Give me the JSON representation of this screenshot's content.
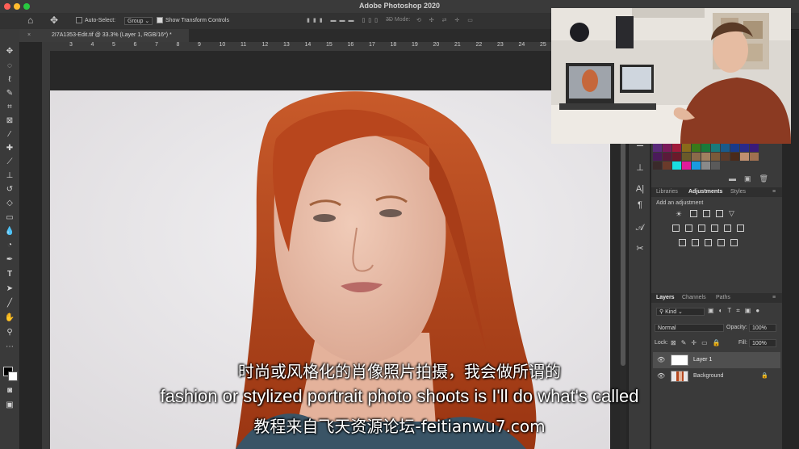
{
  "window": {
    "title": "Adobe Photoshop 2020"
  },
  "options_bar": {
    "auto_select_label": "Auto-Select:",
    "auto_select_value": "Group",
    "show_transform_label": "Show Transform Controls",
    "mode_3d_label": "3D Mode:"
  },
  "document": {
    "tab_title": "2I7A1353-Edit.tif @ 33.3% (Layer 1, RGB/16*) *"
  },
  "ruler": {
    "ticks": [
      "3",
      "4",
      "5",
      "6",
      "7",
      "8",
      "9",
      "10",
      "11",
      "12",
      "13",
      "14",
      "15",
      "16",
      "17",
      "18",
      "19",
      "20",
      "21",
      "22",
      "23",
      "24",
      "25"
    ]
  },
  "colors": {
    "accent": "#cfcfcf",
    "hair": "#b5471e",
    "backdrop": "#e9e7e9"
  },
  "tools": [
    "move-icon",
    "marquee-icon",
    "lasso-icon",
    "quick-select-icon",
    "crop-icon",
    "frame-icon",
    "eyedropper-icon",
    "healing-icon",
    "brush-icon",
    "stamp-icon",
    "history-brush-icon",
    "eraser-icon",
    "gradient-icon",
    "blur-icon",
    "dodge-icon",
    "pen-icon",
    "type-icon",
    "path-select-icon",
    "line-icon",
    "hand-icon",
    "zoom-icon",
    "more-icon"
  ],
  "adjustments_panel": {
    "tabs": [
      "Libraries",
      "Adjustments",
      "Styles"
    ],
    "active_tab": "Adjustments",
    "add_label": "Add an adjustment"
  },
  "layers_panel": {
    "tabs": [
      "Layers",
      "Channels",
      "Paths"
    ],
    "active_tab": "Layers",
    "filter_kind": "Kind",
    "blend_mode": "Normal",
    "opacity_label": "Opacity:",
    "opacity_value": "100%",
    "lock_label": "Lock:",
    "fill_label": "Fill:",
    "fill_value": "100%",
    "layers": [
      {
        "name": "Layer 1",
        "selected": true
      },
      {
        "name": "Background",
        "selected": false,
        "locked": true
      }
    ]
  },
  "subtitles": {
    "chinese": "时尚或风格化的肖像照片拍摄，我会做所谓的",
    "english": "fashion or stylized portrait photo shoots is I'll do what's called",
    "watermark": "教程来自飞天资源论坛-feitianwu7.com"
  }
}
